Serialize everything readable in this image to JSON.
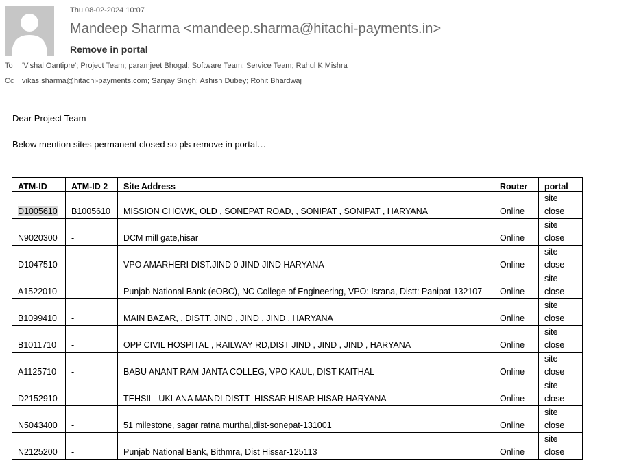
{
  "email": {
    "date": "Thu 08-02-2024 10:07",
    "sender": "Mandeep Sharma <mandeep.sharma@hitachi-payments.in>",
    "subject": "Remove in portal",
    "to_label": "To",
    "to": "'Vishal Oantipre'; Project Team; paramjeet Bhogal; Software Team; Service Team; Rahul K Mishra",
    "cc_label": "Cc",
    "cc": "vikas.sharma@hitachi-payments.com; Sanjay Singh; Ashish Dubey; Rohit Bhardwaj"
  },
  "body": {
    "greeting": "Dear Project Team",
    "message": "Below mention sites permanent closed so pls remove in portal…"
  },
  "table": {
    "headers": [
      "ATM-ID",
      "ATM-ID 2",
      "Site Address",
      "Router",
      "portal"
    ],
    "rows": [
      {
        "atm_id": "D1005610",
        "atm_id2": "B1005610",
        "address": "MISSION CHOWK, OLD , SONEPAT ROAD, , SONIPAT , SONIPAT , HARYANA",
        "router": "Online",
        "portal": "site close"
      },
      {
        "atm_id": "N9020300",
        "atm_id2": "-",
        "address": "DCM mill gate,hisar",
        "router": "Online",
        "portal": "site close"
      },
      {
        "atm_id": "D1047510",
        "atm_id2": "-",
        "address": "VPO AMARHERI DIST.JIND   0   JIND   JIND   HARYANA",
        "router": "Online",
        "portal": "site close"
      },
      {
        "atm_id": "A1522010",
        "atm_id2": "-",
        "address": "Punjab National Bank (eOBC), NC College of Engineering, VPO: Israna, Distt: Panipat-132107",
        "router": "Online",
        "portal": "site close"
      },
      {
        "atm_id": "B1099410",
        "atm_id2": "-",
        "address": "MAIN BAZAR, , DISTT. JIND , JIND , JIND , HARYANA",
        "router": "Online",
        "portal": "site close"
      },
      {
        "atm_id": "B1011710",
        "atm_id2": "-",
        "address": "OPP CIVIL HOSPITAL , RAILWAY RD,DIST JIND , JIND , JIND , HARYANA",
        "router": "Online",
        "portal": "site close"
      },
      {
        "atm_id": "A1125710",
        "atm_id2": "-",
        "address": "BABU ANANT RAM JANTA COLLEG, VPO KAUL, DIST KAITHAL",
        "router": "Online",
        "portal": "site close"
      },
      {
        "atm_id": "D2152910",
        "atm_id2": "-",
        "address": "TEHSIL- UKLANA MANDI   DISTT- HISSAR   HISAR   HISAR   HARYANA",
        "router": "Online",
        "portal": "site close"
      },
      {
        "atm_id": "N5043400",
        "atm_id2": "-",
        "address": "51 milestone, sagar ratna murthal,dist-sonepat-131001",
        "router": "Online",
        "portal": "site close"
      },
      {
        "atm_id": "N2125200",
        "atm_id2": "-",
        "address": "Punjab National Bank, Bithmra, Dist Hissar-125113",
        "router": "Online",
        "portal": "site close"
      }
    ]
  }
}
